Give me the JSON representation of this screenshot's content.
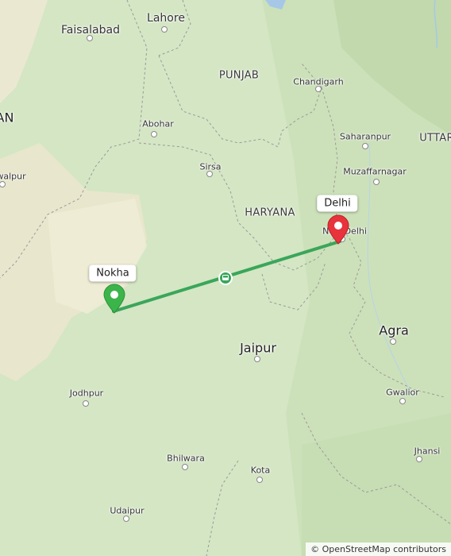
{
  "labels": {
    "faisalabad": "Faisalabad",
    "lahore": "Lahore",
    "punjab": "PUNJAB",
    "chandigarh": "Chandigarh",
    "an": "AN",
    "abohar": "Abohar",
    "saharanpur": "Saharanpur",
    "uttar": "UTTAR",
    "sirsa": "Sirsa",
    "muzaffarnagar": "Muzaffarnagar",
    "walpur": "walpur",
    "haryana": "HARYANA",
    "new_delhi": "New Delhi",
    "jaipur": "Jaipur",
    "agra": "Agra",
    "jodhpur": "Jodhpur",
    "gwalior": "Gwalior",
    "bhilwara": "Bhilwara",
    "jhansi": "Jhansi",
    "kota": "Kota",
    "udaipur": "Udaipur"
  },
  "route": {
    "origin": "Nokha",
    "destination": "Delhi",
    "color": "#3aa65a",
    "transport_icon": "bus-icon"
  },
  "markers": {
    "origin_color": "#3bb54a",
    "destination_color": "#e8323c"
  },
  "attribution": {
    "copyright_symbol": "©",
    "text": "OpenStreetMap contributors"
  }
}
